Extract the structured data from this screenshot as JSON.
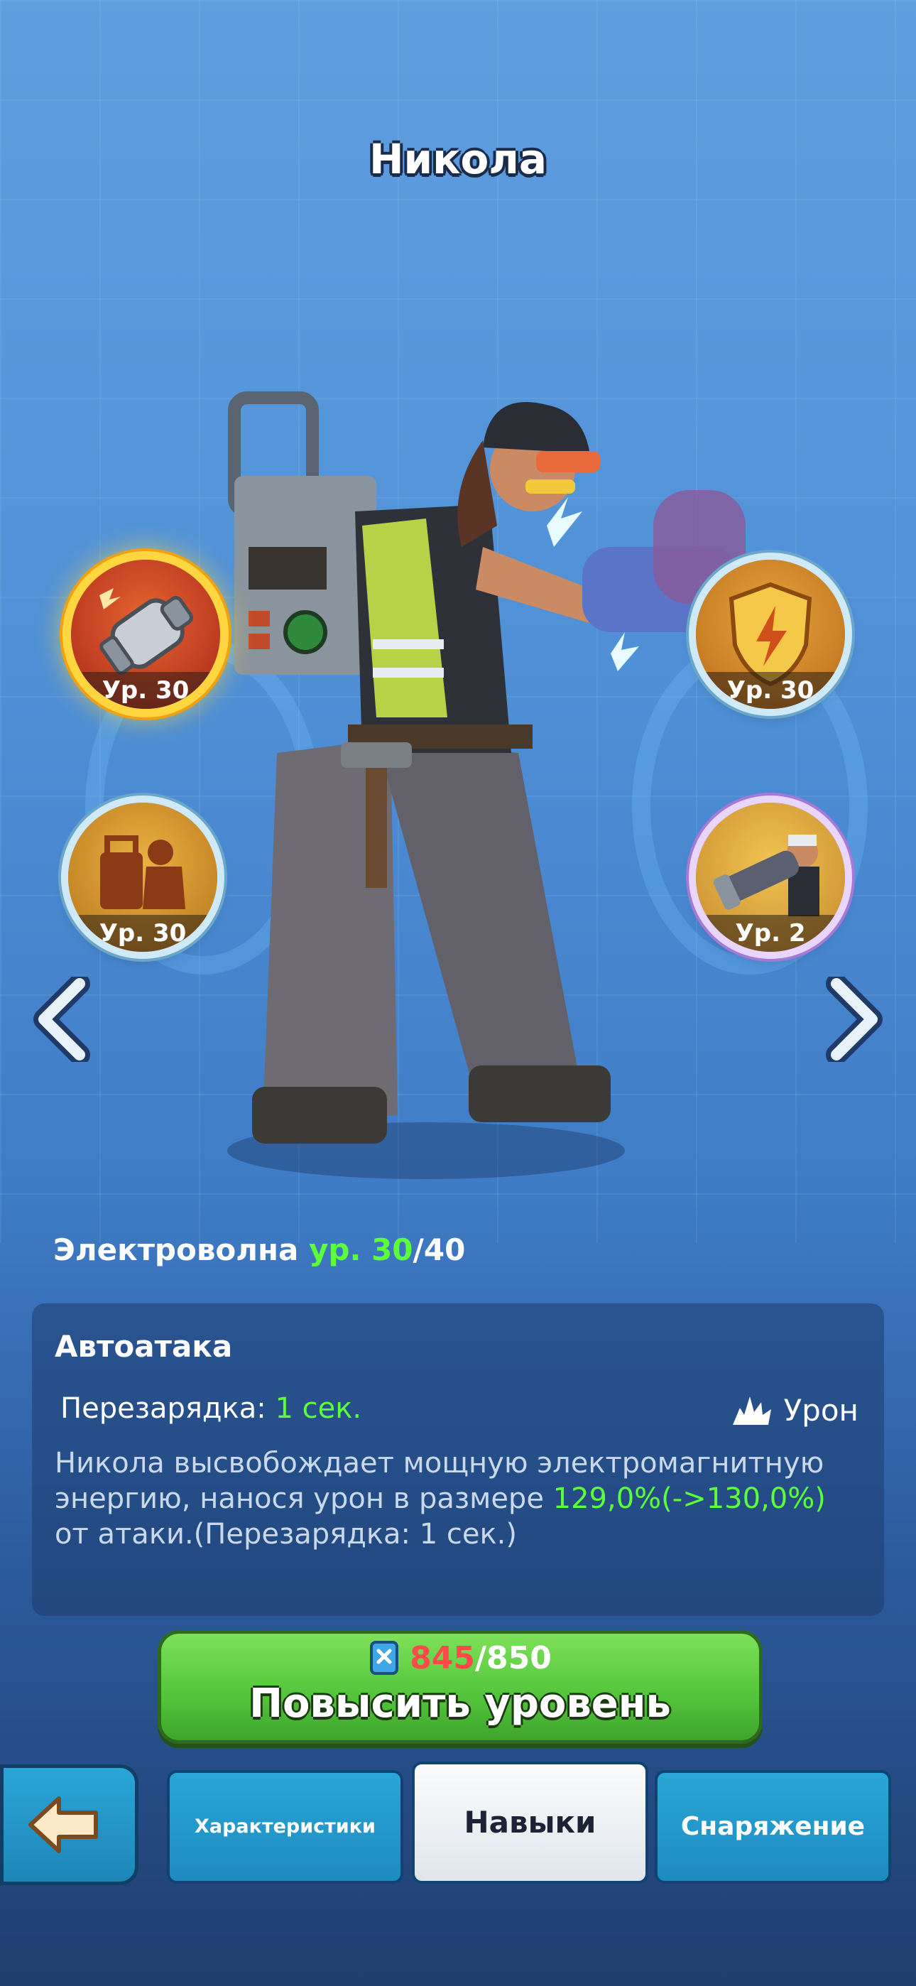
{
  "hero": {
    "name": "Никола"
  },
  "skills": [
    {
      "id": "electro-wave",
      "level_text": "Ур. 30",
      "selected": true
    },
    {
      "id": "shield-lightning",
      "level_text": "Ур. 30",
      "selected": false
    },
    {
      "id": "machine-silhouette",
      "level_text": "Ур. 30",
      "selected": false
    },
    {
      "id": "hero-with-cannon",
      "level_text": "Ур. 2",
      "selected": false
    }
  ],
  "skill_info": {
    "name": "Электроволна",
    "level_prefix": "ур.",
    "level_current": "30",
    "level_max": "/40",
    "type": "Автоатака",
    "cooldown_label": "Перезарядка:",
    "cooldown_value": "1 сек.",
    "damage_label": "Урон",
    "desc_part1": "Никола высвобождает мощную электромагнитную энергию, нанося урон в размере ",
    "desc_highlight": "129,0%(->130,0%)",
    "desc_part2": " от атаки.(Перезарядка: 1 сек.)"
  },
  "upgrade": {
    "cost_current": "845",
    "cost_total": "/850",
    "label": "Повысить уровень"
  },
  "tabs": [
    {
      "label": "Характеристики",
      "active": false
    },
    {
      "label": "Навыки",
      "active": true
    },
    {
      "label": "Снаряжение",
      "active": false
    }
  ],
  "colors": {
    "accent_green": "#5dff3a",
    "cost_red": "#ff4a4a",
    "selected_ring": "#ffd640"
  }
}
